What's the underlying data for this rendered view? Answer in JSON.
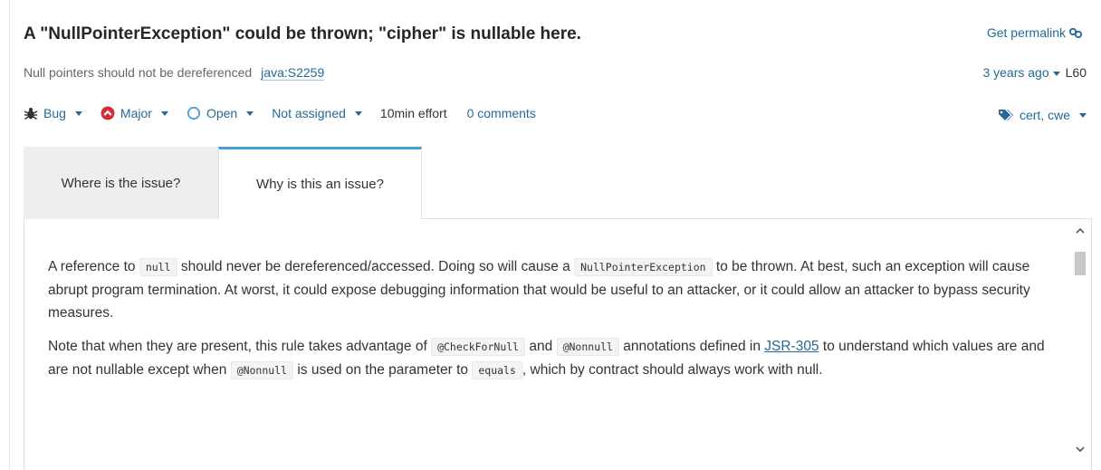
{
  "issue": {
    "title": "A \"NullPointerException\" could be thrown; \"cipher\" is nullable here.",
    "permalink_label": "Get permalink",
    "rule_name": "Null pointers should not be dereferenced",
    "rule_key": "java:S2259",
    "age": "3 years ago",
    "line": "L60"
  },
  "toolbar": {
    "type": "Bug",
    "severity": "Major",
    "status": "Open",
    "assignee": "Not assigned",
    "effort": "10min effort",
    "comments": "0 comments",
    "tags": "cert, cwe"
  },
  "tabs": {
    "where": "Where is the issue?",
    "why": "Why is this an issue?"
  },
  "description": {
    "p1": {
      "t1": "A reference to ",
      "c1": "null",
      "t2": " should never be dereferenced/accessed. Doing so will cause a ",
      "c2": "NullPointerException",
      "t3": " to be thrown. At best, such an exception will cause abrupt program termination. At worst, it could expose debugging information that would be useful to an attacker, or it could allow an attacker to bypass security measures."
    },
    "p2": {
      "t1": "Note that when they are present, this rule takes advantage of ",
      "c1": "@CheckForNull",
      "t2": " and ",
      "c2": "@Nonnull",
      "t3": " annotations defined in ",
      "link": "JSR-305",
      "t4": " to understand which values are and are not nullable except when ",
      "c3": "@Nonnull",
      "t5": " is used on the parameter to ",
      "c4": "equals",
      "t6": ", which by contract should always work with null."
    }
  },
  "colors": {
    "link": "#236a97",
    "severity_major": "#d02f3a",
    "active_tab_border": "#4b9fd5"
  },
  "icons": [
    "bug-icon",
    "major-severity-icon",
    "open-status-icon",
    "link-icon",
    "tags-icon",
    "scroll-up-icon",
    "scroll-down-icon"
  ]
}
